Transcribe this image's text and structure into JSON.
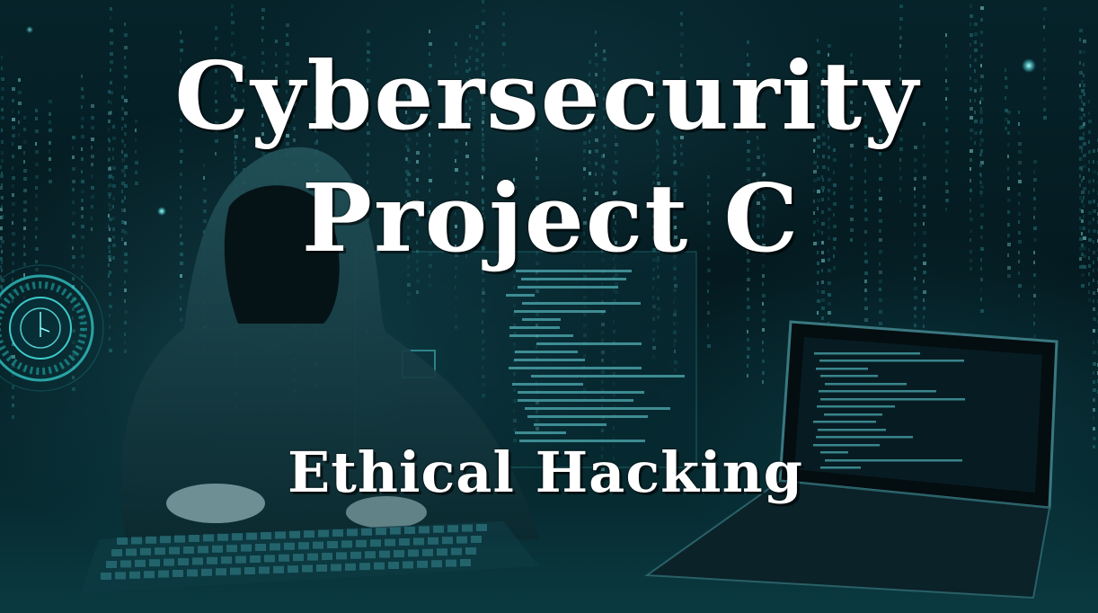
{
  "title": {
    "line1": "Cybersecurity",
    "line2": "Project C"
  },
  "subtitle": "Ethical Hacking",
  "palette": {
    "background": "#041a20",
    "accent_teal": "#2fd0d0",
    "text": "#ffffff"
  },
  "scene_elements": [
    "hooded-figure",
    "matrix-code-rain",
    "radar-hud-dial",
    "holographic-screen",
    "laptop",
    "keyboard"
  ]
}
